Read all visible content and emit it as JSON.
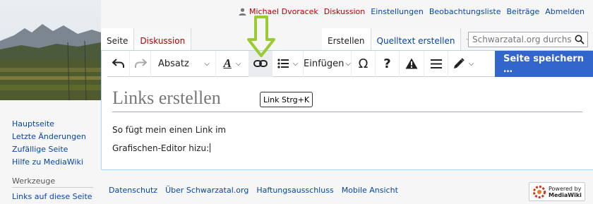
{
  "personal_tools": {
    "username": "Michael Dvoracek",
    "links": [
      "Diskussion",
      "Einstellungen",
      "Beobachtungsliste",
      "Beiträge",
      "Abmelden"
    ]
  },
  "tabs": {
    "left": [
      "Seite",
      "Diskussion"
    ],
    "right": [
      "Erstellen",
      "Quelltext erstellen"
    ]
  },
  "search": {
    "placeholder": "Schwarzatal.org durchsu"
  },
  "toolbar": {
    "paragraph_label": "Absatz",
    "insert_label": "Einfügen",
    "save_label": "Seite speichern …",
    "link_tooltip": "Link Strg+K"
  },
  "page": {
    "title": "Links erstellen",
    "line1": "So fügt mein einen Link im",
    "line2": "Grafischen-Editor hizu:"
  },
  "sidebar": {
    "nav": [
      "Hauptseite",
      "Letzte Änderungen",
      "Zufällige Seite",
      "Hilfe zu MediaWiki"
    ],
    "tools_heading": "Werkzeuge",
    "tools_link": "Links auf diese Seite"
  },
  "footer": {
    "links": [
      "Datenschutz",
      "Über Schwarzatal.org",
      "Haftungsausschluss",
      "Mobile Ansicht"
    ],
    "powered_line1": "Powered by",
    "powered_line2": "MediaWiki"
  },
  "colors": {
    "accent": "#3366cc",
    "annotation_arrow": "#99cc33",
    "redlink": "#ba0000",
    "link": "#0645ad"
  }
}
